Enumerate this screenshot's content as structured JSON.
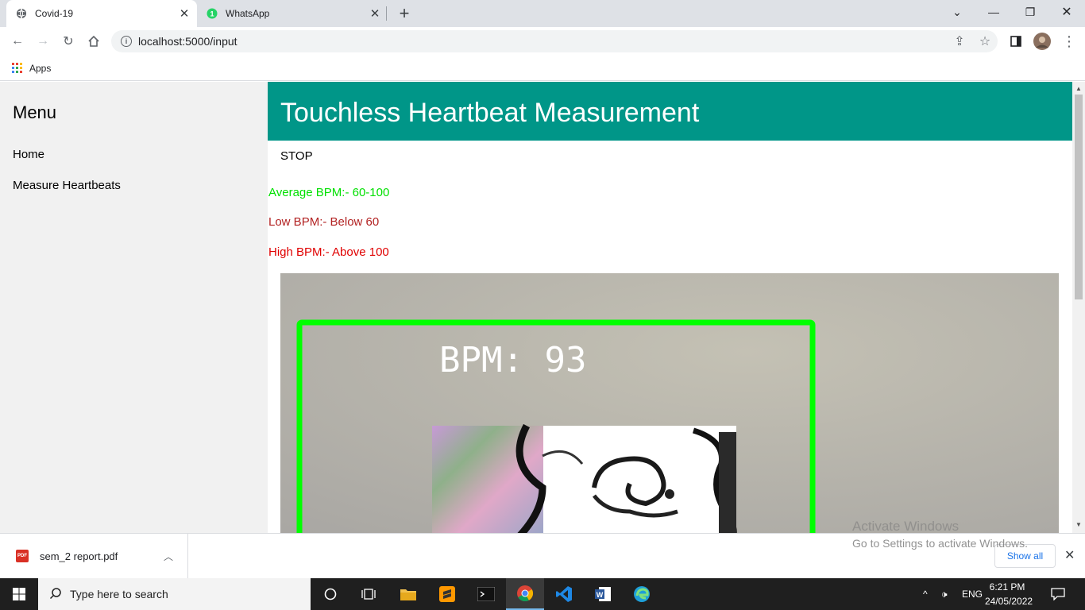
{
  "browser": {
    "tabs": [
      {
        "title": "Covid-19",
        "active": true
      },
      {
        "title": "WhatsApp",
        "active": false,
        "badge": "1"
      }
    ],
    "url": "localhost:5000/input",
    "bookmarks": {
      "apps_label": "Apps"
    }
  },
  "sidebar": {
    "title": "Menu",
    "items": [
      {
        "label": "Home"
      },
      {
        "label": "Measure Heartbeats"
      }
    ]
  },
  "main": {
    "header_title": "Touchless Heartbeat Measurement",
    "stop_label": "STOP",
    "bpm_info": [
      {
        "text": "Average BPM:- 60-100",
        "color": "#00e000"
      },
      {
        "text": "Low BPM:- Below 60",
        "color": "#b22222"
      },
      {
        "text": "High BPM:- Above 100",
        "color": "#e00000"
      }
    ],
    "video": {
      "overlay_text": "BPM: 93",
      "frame_color": "#00ff00"
    }
  },
  "watermark": {
    "line1": "Activate Windows",
    "line2": "Go to Settings to activate Windows."
  },
  "downloads": {
    "file_name": "sem_2 report.pdf",
    "show_all_label": "Show all"
  },
  "taskbar": {
    "search_placeholder": "Type here to search",
    "language": "ENG",
    "time": "6:21 PM",
    "date": "24/05/2022"
  },
  "colors": {
    "header_bg": "#009688",
    "sidebar_bg": "#f1f1f1",
    "accent": "#1a73e8"
  }
}
